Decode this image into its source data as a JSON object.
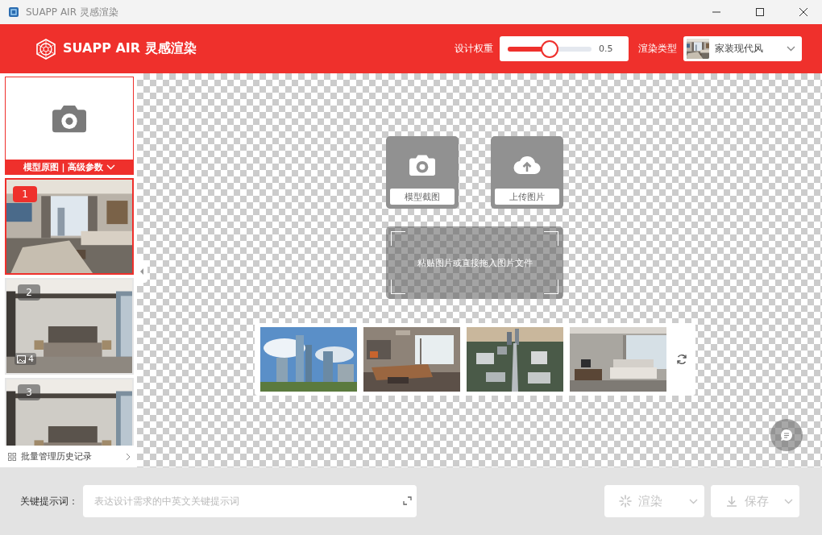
{
  "window": {
    "title": "SUAPP AIR 灵感渲染"
  },
  "header": {
    "brand": "SUAPP AIR 灵感渲染",
    "weight": {
      "label": "设计权重",
      "level": 0.5,
      "reading": "0.5"
    },
    "render_type": {
      "label": "渲染类型",
      "value": "家装现代风"
    }
  },
  "sidebar": {
    "upload_card": {
      "label": "模型原图 | 高级参数"
    },
    "history": [
      {
        "badge": "1",
        "selected": true
      },
      {
        "badge": "2",
        "selected": false,
        "count": "4"
      },
      {
        "badge": "3",
        "selected": false
      }
    ],
    "manage_link": "批量管理历史记录"
  },
  "canvas": {
    "actions": [
      {
        "kind": "capture",
        "label": "模型截图"
      },
      {
        "kind": "upload",
        "label": "上传图片"
      }
    ],
    "drop_zone": "粘贴图片或直接拖入图片文件"
  },
  "prompt": {
    "label": "关键提示词：",
    "placeholder": "表达设计需求的中英文关键提示词"
  },
  "buttons": [
    {
      "kind": "render",
      "label": "渲染",
      "disabled": true
    },
    {
      "kind": "save",
      "label": "保存",
      "disabled": true
    }
  ]
}
